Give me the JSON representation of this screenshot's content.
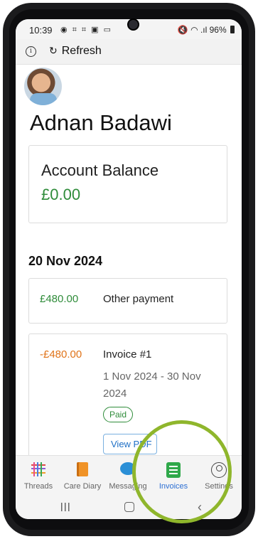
{
  "status_bar": {
    "time": "10:39",
    "notification_icons": "◉ ⌗ ⌗ ▣ ▭",
    "right_icons": "🔇 ◠ .ıl",
    "battery": "96%"
  },
  "action_bar": {
    "info_glyph": "i",
    "refresh_glyph": "↻",
    "refresh_label": "Refresh"
  },
  "profile": {
    "name": "Adnan Badawi"
  },
  "balance": {
    "title": "Account Balance",
    "value": "£0.00",
    "value_color": "#2f8c3a"
  },
  "date_heading": "20 Nov 2024",
  "transactions": [
    {
      "amount": "£480.00",
      "description": "Other payment",
      "amount_color": "#2f8c3a"
    },
    {
      "amount": "-£480.00",
      "title": "Invoice #1",
      "period": "1 Nov 2024 - 30 Nov 2024",
      "status": "Paid",
      "button": "View PDF",
      "amount_color": "#e0741a"
    }
  ],
  "tabs": [
    {
      "label": "Threads",
      "icon": "threads-grid-icon"
    },
    {
      "label": "Care Diary",
      "icon": "book-icon"
    },
    {
      "label": "Messaging",
      "icon": "speech-bubble-icon"
    },
    {
      "label": "Invoices",
      "icon": "invoice-document-icon",
      "active": true
    },
    {
      "label": "Settings",
      "icon": "person-icon"
    }
  ],
  "colors": {
    "active_tab": "#2d6fd3",
    "highlight_ring": "#8fb62c"
  }
}
